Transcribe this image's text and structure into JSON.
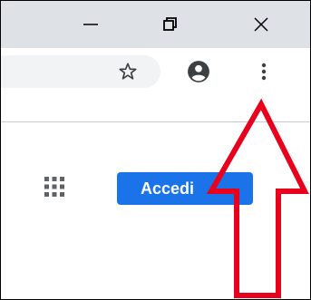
{
  "colors": {
    "titlebar": "#dee1e6",
    "toolbar": "#ffffff",
    "omnibox": "#f1f3f4",
    "accent": "#1a73e8",
    "annotation": "#e8001c",
    "icon": "#3c4043"
  },
  "window_controls": {
    "minimize_icon": "minimize-icon",
    "maximize_icon": "restore-icon",
    "close_icon": "close-icon"
  },
  "toolbar": {
    "bookmark_icon": "star-icon",
    "profile_icon": "account-circle-icon",
    "menu_icon": "three-dots-vertical-icon"
  },
  "page": {
    "apps_icon": "apps-grid-icon",
    "signin_label": "Accedi"
  },
  "annotation": {
    "type": "arrow",
    "direction": "up",
    "target": "three-dots-vertical-icon"
  }
}
